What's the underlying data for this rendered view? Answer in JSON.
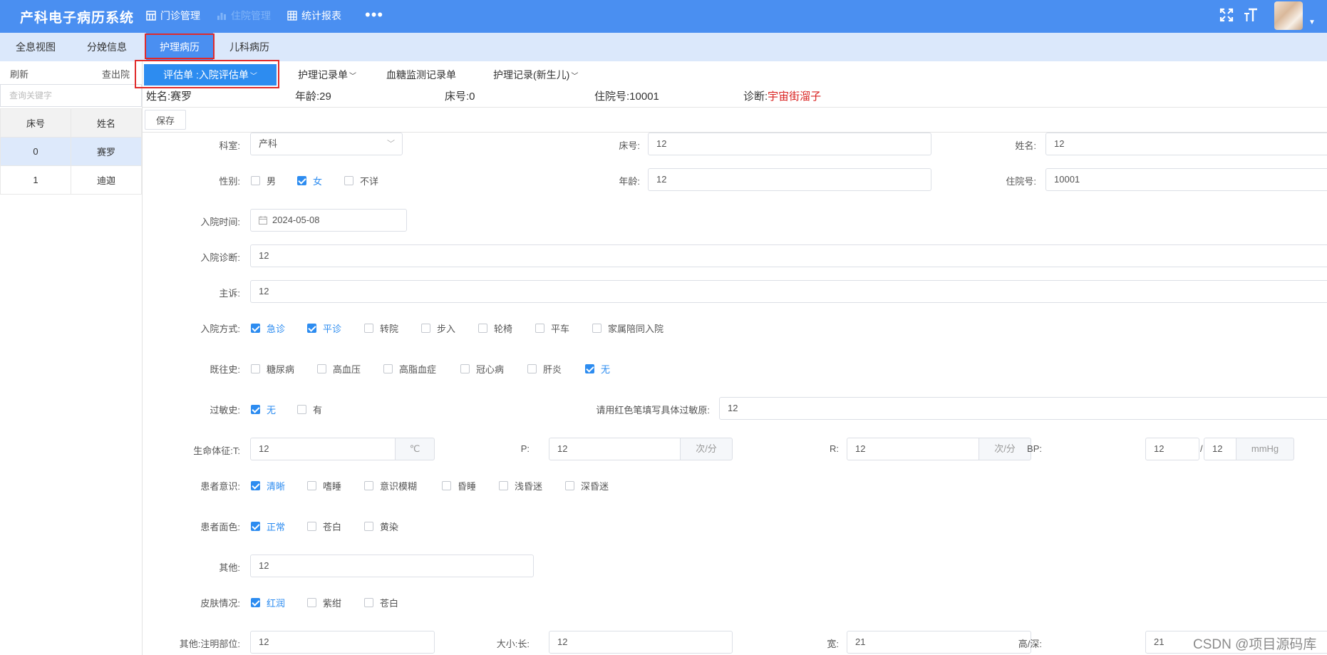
{
  "app": {
    "title": "产科电子病历系统"
  },
  "topnav": [
    {
      "label": "门诊管理",
      "icon": "table-icon"
    },
    {
      "label": "住院管理",
      "icon": "chart-icon"
    },
    {
      "label": "统计报表",
      "icon": "grid-icon"
    }
  ],
  "more_label": "•••",
  "header_icons": [
    "fullscreen-icon",
    "font-size-icon"
  ],
  "tabs": [
    "全息视图",
    "分娩信息",
    "护理病历",
    "儿科病历"
  ],
  "active_tab": "护理病历",
  "left": {
    "refresh": "刷新",
    "discharged": "查出院",
    "search_placeholder": "查询关键字",
    "columns": [
      "床号",
      "姓名"
    ],
    "rows": [
      {
        "bed": "0",
        "name": "赛罗"
      },
      {
        "bed": "1",
        "name": "迪迦"
      }
    ]
  },
  "subtabs": [
    {
      "label": "评估单 :入院评估单",
      "dropdown": true
    },
    {
      "label": "护理记录单",
      "dropdown": true
    },
    {
      "label": "血糖监测记录单",
      "dropdown": false
    },
    {
      "label": "护理记录(新生儿)",
      "dropdown": true
    }
  ],
  "patient": {
    "name_label": "姓名:",
    "name": "赛罗",
    "age_label": "年龄:",
    "age": "29",
    "bed_label": "床号:",
    "bed": "0",
    "admission_label": "住院号:",
    "admission_no": "10001",
    "diagnosis_label": "诊断:",
    "diagnosis": "宇宙街溜子"
  },
  "save_label": "保存",
  "form": {
    "dept_label": "科室:",
    "dept": "产科",
    "bed_label": "床号:",
    "bed": "12",
    "name_label": "姓名:",
    "name": "12",
    "gender_label": "性别:",
    "gender_options": [
      {
        "label": "男",
        "checked": false
      },
      {
        "label": "女",
        "checked": true
      },
      {
        "label": "不详",
        "checked": false
      }
    ],
    "age_label": "年龄:",
    "age": "12",
    "admission_label": "住院号:",
    "admission_no": "10001",
    "admit_time_label": "入院时间:",
    "admit_time": "2024-05-08",
    "admit_diag_label": "入院诊断:",
    "admit_diag": "12",
    "complaint_label": "主诉:",
    "complaint": "12",
    "admit_mode_label": "入院方式:",
    "admit_mode_options": [
      {
        "label": "急诊",
        "checked": true
      },
      {
        "label": "平诊",
        "checked": true
      },
      {
        "label": "转院",
        "checked": false
      },
      {
        "label": "步入",
        "checked": false
      },
      {
        "label": "轮椅",
        "checked": false
      },
      {
        "label": "平车",
        "checked": false
      },
      {
        "label": "家属陪同入院",
        "checked": false
      }
    ],
    "history_label": "既往史:",
    "history_options": [
      {
        "label": "糖尿病",
        "checked": false
      },
      {
        "label": "高血压",
        "checked": false
      },
      {
        "label": "高脂血症",
        "checked": false
      },
      {
        "label": "冠心病",
        "checked": false
      },
      {
        "label": "肝炎",
        "checked": false
      },
      {
        "label": "无",
        "checked": true
      }
    ],
    "allergy_label": "过敏史:",
    "allergy_options": [
      {
        "label": "无",
        "checked": true
      },
      {
        "label": "有",
        "checked": false
      }
    ],
    "allergy_detail_label": "请用红色笔填写具体过敏原:",
    "allergy_detail": "12",
    "vitals_label": "生命体征:T:",
    "t": "12",
    "t_unit": "℃",
    "p_label": "P:",
    "p": "12",
    "p_unit": "次/分",
    "r_label": "R:",
    "r": "12",
    "r_unit": "次/分",
    "bp_label": "BP:",
    "bp_sys": "12",
    "bp_sep": "/",
    "bp_dia": "12",
    "bp_unit": "mmHg",
    "consciousness_label": "患者意识:",
    "consciousness_options": [
      {
        "label": "清晰",
        "checked": true
      },
      {
        "label": "嗜睡",
        "checked": false
      },
      {
        "label": "意识模糊",
        "checked": false
      },
      {
        "label": "昏睡",
        "checked": false
      },
      {
        "label": "浅昏迷",
        "checked": false
      },
      {
        "label": "深昏迷",
        "checked": false
      }
    ],
    "complexion_label": "患者面色:",
    "complexion_options": [
      {
        "label": "正常",
        "checked": true
      },
      {
        "label": "苍白",
        "checked": false
      },
      {
        "label": "黄染",
        "checked": false
      }
    ],
    "other_label": "其他:",
    "other": "12",
    "skin_label": "皮肤情况:",
    "skin_options": [
      {
        "label": "红润",
        "checked": true
      },
      {
        "label": "紫绀",
        "checked": false
      },
      {
        "label": "苍白",
        "checked": false
      }
    ],
    "site_label": "其他:注明部位:",
    "site": "12",
    "size_label": "大小:长:",
    "length": "12",
    "width_label": "宽:",
    "width": "21",
    "depth_label": "高/深:",
    "depth": "21"
  },
  "watermark": "CSDN @项目源码库",
  "colors": {
    "header": "#4a8ff1",
    "tabbar": "#dbe8fb",
    "accent": "#2d8cf0",
    "highlight": "#e02a2a",
    "diagnosis": "#d9211f"
  }
}
